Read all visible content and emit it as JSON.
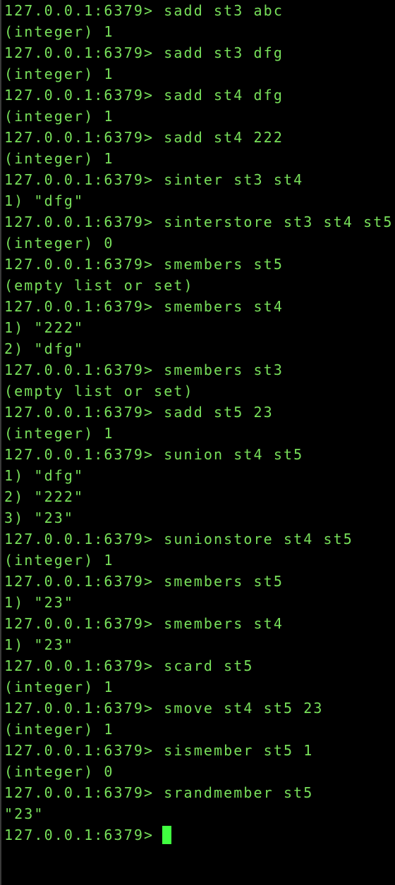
{
  "terminal": {
    "prompt": "127.0.0.1:6379>",
    "colors": {
      "background": "#000000",
      "text": "#78e05a",
      "cursor": "#40ff40"
    },
    "history": [
      {
        "kind": "cmd",
        "text": "sadd st3 abc"
      },
      {
        "kind": "out",
        "text": "(integer) 1"
      },
      {
        "kind": "cmd",
        "text": "sadd st3 dfg"
      },
      {
        "kind": "out",
        "text": "(integer) 1"
      },
      {
        "kind": "cmd",
        "text": "sadd st4 dfg"
      },
      {
        "kind": "out",
        "text": "(integer) 1"
      },
      {
        "kind": "cmd",
        "text": "sadd st4 222"
      },
      {
        "kind": "out",
        "text": "(integer) 1"
      },
      {
        "kind": "cmd",
        "text": "sinter st3 st4"
      },
      {
        "kind": "out",
        "text": "1) \"dfg\""
      },
      {
        "kind": "cmd",
        "text": "sinterstore st3 st4 st5"
      },
      {
        "kind": "out",
        "text": "(integer) 0"
      },
      {
        "kind": "cmd",
        "text": "smembers st5"
      },
      {
        "kind": "out",
        "text": "(empty list or set)"
      },
      {
        "kind": "cmd",
        "text": "smembers st4"
      },
      {
        "kind": "out",
        "text": "1) \"222\""
      },
      {
        "kind": "out",
        "text": "2) \"dfg\""
      },
      {
        "kind": "cmd",
        "text": "smembers st3"
      },
      {
        "kind": "out",
        "text": "(empty list or set)"
      },
      {
        "kind": "cmd",
        "text": "sadd st5 23"
      },
      {
        "kind": "out",
        "text": "(integer) 1"
      },
      {
        "kind": "cmd",
        "text": "sunion st4 st5"
      },
      {
        "kind": "out",
        "text": "1) \"dfg\""
      },
      {
        "kind": "out",
        "text": "2) \"222\""
      },
      {
        "kind": "out",
        "text": "3) \"23\""
      },
      {
        "kind": "cmd",
        "text": "sunionstore st4 st5"
      },
      {
        "kind": "out",
        "text": "(integer) 1"
      },
      {
        "kind": "cmd",
        "text": "smembers st5"
      },
      {
        "kind": "out",
        "text": "1) \"23\""
      },
      {
        "kind": "cmd",
        "text": "smembers st4"
      },
      {
        "kind": "out",
        "text": "1) \"23\""
      },
      {
        "kind": "cmd",
        "text": "scard st5"
      },
      {
        "kind": "out",
        "text": "(integer) 1"
      },
      {
        "kind": "cmd",
        "text": "smove st4 st5 23"
      },
      {
        "kind": "out",
        "text": "(integer) 1"
      },
      {
        "kind": "cmd",
        "text": "sismember st5 1"
      },
      {
        "kind": "out",
        "text": "(integer) 0"
      },
      {
        "kind": "cmd",
        "text": "srandmember st5"
      },
      {
        "kind": "out",
        "text": "\"23\""
      }
    ],
    "current_input": ""
  }
}
